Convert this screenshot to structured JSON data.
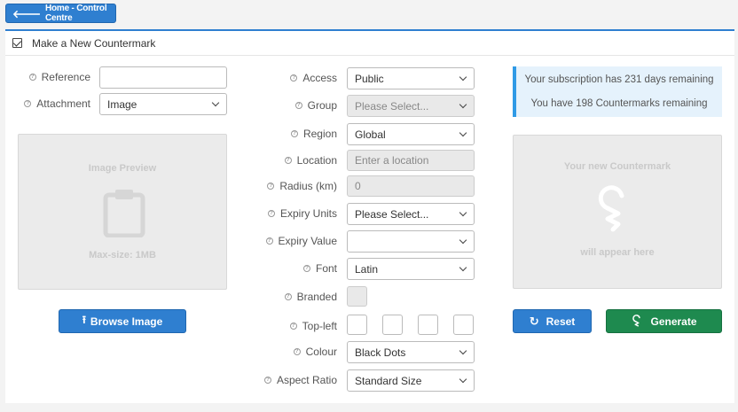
{
  "home_button": {
    "label": "Home - Control Centre",
    "icon": "arrow-left-icon"
  },
  "panel": {
    "title": "Make a New Countermark"
  },
  "left": {
    "reference_label": "Reference",
    "reference_value": "",
    "attachment_label": "Attachment",
    "attachment_value": "Image",
    "preview_title": "Image Preview",
    "preview_size": "Max-size: 1MB",
    "browse_label": "Browse Image"
  },
  "middle": {
    "access_label": "Access",
    "access_value": "Public",
    "group_label": "Group",
    "group_value": "Please Select...",
    "region_label": "Region",
    "region_value": "Global",
    "location_label": "Location",
    "location_placeholder": "Enter a location",
    "radius_label": "Radius (km)",
    "radius_placeholder": "0",
    "expiry_units_label": "Expiry Units",
    "expiry_units_value": "Please Select...",
    "expiry_value_label": "Expiry Value",
    "expiry_value_value": "",
    "font_label": "Font",
    "font_value": "Latin",
    "branded_label": "Branded",
    "topleft_label": "Top-left",
    "colour_label": "Colour",
    "colour_value": "Black Dots",
    "aspect_label": "Aspect Ratio",
    "aspect_value": "Standard Size"
  },
  "right": {
    "subscription_text": "Your subscription has 231 days remaining",
    "countermarks_text": "You have 198 Countermarks remaining",
    "preview_title": "Your new Countermark",
    "preview_sub": "will appear here",
    "reset_label": "Reset",
    "generate_label": "Generate"
  },
  "colors": {
    "primary": "#2f7fd0",
    "success": "#1e8a4f",
    "info_bg": "#e5f2fc"
  }
}
